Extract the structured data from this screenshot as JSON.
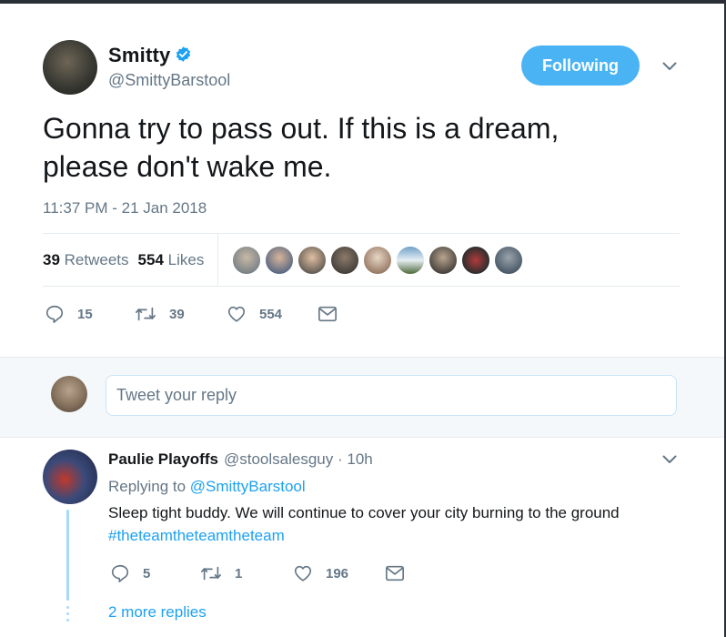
{
  "tweet": {
    "author_name": "Smitty",
    "author_handle": "@SmittyBarstool",
    "follow_label": "Following",
    "text": "Gonna try to pass out.  If this is a dream,\nplease don't wake me.",
    "timestamp": "11:37 PM - 21 Jan 2018",
    "retweets_count": "39",
    "retweets_label": "Retweets",
    "likes_count": "554",
    "likes_label": "Likes",
    "actions": {
      "replies": "15",
      "retweets": "39",
      "likes": "554"
    }
  },
  "reply_box": {
    "placeholder": "Tweet your reply"
  },
  "reply": {
    "author_name": "Paulie Playoffs",
    "meta": "@stoolsalesguy · 10h",
    "replying_prefix": "Replying to",
    "replying_to": "@SmittyBarstool",
    "text": "Sleep tight buddy. We will continue to cover your city burning to the ground",
    "hashtag": "#theteamtheteamtheteam",
    "actions": {
      "replies": "5",
      "retweets": "1",
      "likes": "196"
    },
    "more_replies": "2 more replies"
  },
  "colors": {
    "accent": "#1da1f2",
    "follow_button": "#4ab3f4",
    "muted": "#657786",
    "thread_line": "#a6d8fa"
  }
}
